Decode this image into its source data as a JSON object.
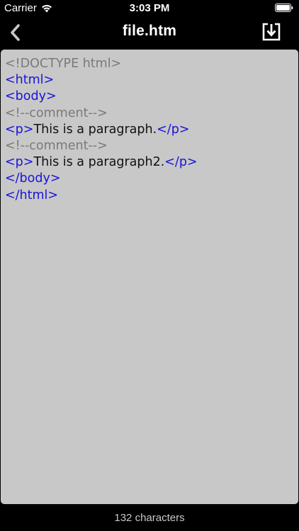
{
  "status_bar": {
    "carrier": "Carrier",
    "time": "3:03 PM",
    "wifi_icon": "wifi-icon",
    "battery_icon": "battery-icon"
  },
  "nav_bar": {
    "title": "file.htm",
    "back_icon": "chevron-left-icon",
    "save_icon": "download-icon"
  },
  "editor": {
    "lines": [
      {
        "tokens": [
          {
            "type": "doctype",
            "text": "<!DOCTYPE html>"
          }
        ]
      },
      {
        "tokens": [
          {
            "type": "tag",
            "text": "<html>"
          }
        ]
      },
      {
        "tokens": [
          {
            "type": "tag",
            "text": "<body>"
          }
        ]
      },
      {
        "tokens": [
          {
            "type": "comment",
            "text": "<!--comment-->"
          }
        ]
      },
      {
        "tokens": [
          {
            "type": "tag",
            "text": "<p>"
          },
          {
            "type": "text",
            "text": "This is a paragraph."
          },
          {
            "type": "tag",
            "text": "</p>"
          }
        ]
      },
      {
        "tokens": [
          {
            "type": "comment",
            "text": "<!--comment-->"
          }
        ]
      },
      {
        "tokens": [
          {
            "type": "tag",
            "text": "<p>"
          },
          {
            "type": "text",
            "text": "This is a paragraph2."
          },
          {
            "type": "tag",
            "text": "</p>"
          }
        ]
      },
      {
        "tokens": [
          {
            "type": "tag",
            "text": "</body>"
          }
        ]
      },
      {
        "tokens": [
          {
            "type": "tag",
            "text": "</html>"
          }
        ]
      }
    ],
    "colors": {
      "tag": "#1a14d8",
      "doctype": "#7a7a7a",
      "comment": "#7a7a7a",
      "text": "#111111",
      "background": "#c8c8c8"
    }
  },
  "footer": {
    "char_count": "132 characters"
  }
}
